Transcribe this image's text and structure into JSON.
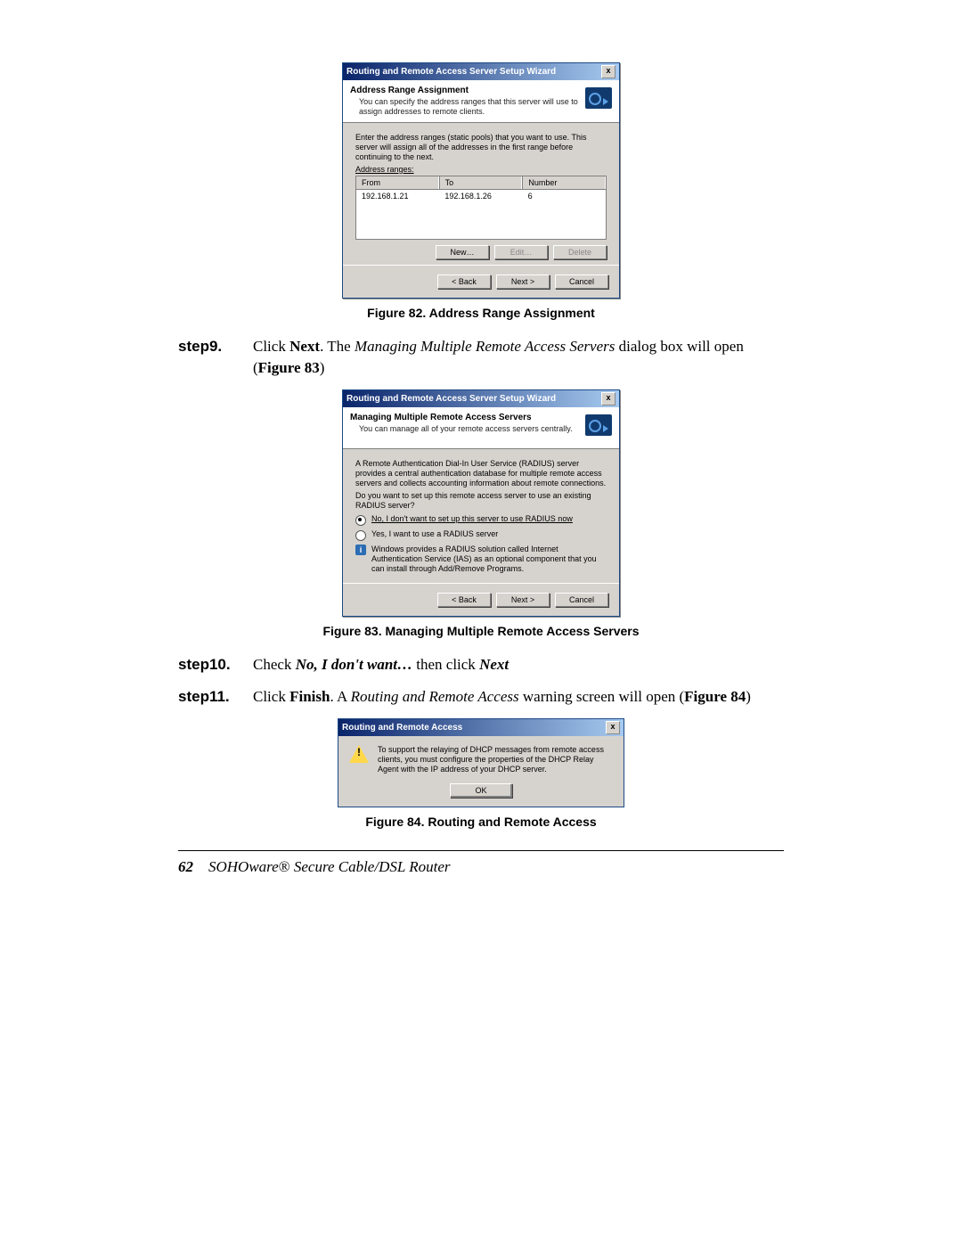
{
  "dialog1": {
    "title": "Routing and Remote Access Server Setup Wizard",
    "close_glyph": "x",
    "banner_title": "Address Range Assignment",
    "banner_sub": "You can specify the address ranges that this server will use to assign addresses to remote clients.",
    "instr": "Enter the address ranges (static pools) that you want to use. This server will assign all of the addresses in the first range before continuing to the next.",
    "ranges_label": "Address ranges:",
    "col_from": "From",
    "col_to": "To",
    "col_number": "Number",
    "row_from": "192.168.1.21",
    "row_to": "192.168.1.26",
    "row_number": "6",
    "btn_new": "New…",
    "btn_edit": "Edit…",
    "btn_delete": "Delete",
    "btn_back": "< Back",
    "btn_next": "Next >",
    "btn_cancel": "Cancel"
  },
  "fig82": "Figure 82. Address Range Assignment",
  "step9": {
    "label": "step9.",
    "t1": "Click ",
    "t2": "Next",
    "t3": ".  The ",
    "t4": "Managing Multiple Remote Access Servers",
    "t5": " dialog box will open (",
    "t6": "Figure 83",
    "t7": ")"
  },
  "dialog2": {
    "title": "Routing and Remote Access Server Setup Wizard",
    "close_glyph": "x",
    "banner_title": "Managing Multiple Remote Access Servers",
    "banner_sub": "You can manage all of your remote access servers centrally.",
    "para1": "A Remote Authentication Dial-In User Service (RADIUS) server provides a central authentication database for multiple remote access servers and collects accounting information about remote connections.",
    "question": "Do you want to set up this remote access server to use an existing RADIUS server?",
    "opt_no": "No, I don't want to set up this server to use RADIUS now",
    "opt_yes": "Yes, I want to use a RADIUS server",
    "info_glyph": "i",
    "info_text": "Windows provides a RADIUS solution called Internet Authentication Service (IAS) as an optional component that you can install through Add/Remove Programs.",
    "btn_back": "< Back",
    "btn_next": "Next >",
    "btn_cancel": "Cancel"
  },
  "fig83": "Figure 83. Managing Multiple Remote Access Servers",
  "step10": {
    "label": "step10.",
    "t1": "Check ",
    "t2": "No, I don't want…",
    "t3": "  then click ",
    "t4": "Next"
  },
  "step11": {
    "label": "step11.",
    "t1": "Click ",
    "t2": "Finish",
    "t3": ".  A ",
    "t4": "Routing and Remote Access",
    "t5": " warning screen will open (",
    "t6": "Figure 84",
    "t7": ")"
  },
  "msgbox": {
    "title": "Routing and Remote Access",
    "close_glyph": "x",
    "text": "To support the relaying of DHCP messages from remote access clients, you must configure the properties of the DHCP Relay Agent with the IP address of your DHCP server.",
    "btn_ok": "OK"
  },
  "fig84": "Figure 84. Routing and Remote Access",
  "footer": {
    "page": "62",
    "brand": "SOHOware",
    "reg": "®",
    "rest": " Secure Cable/DSL Router"
  }
}
